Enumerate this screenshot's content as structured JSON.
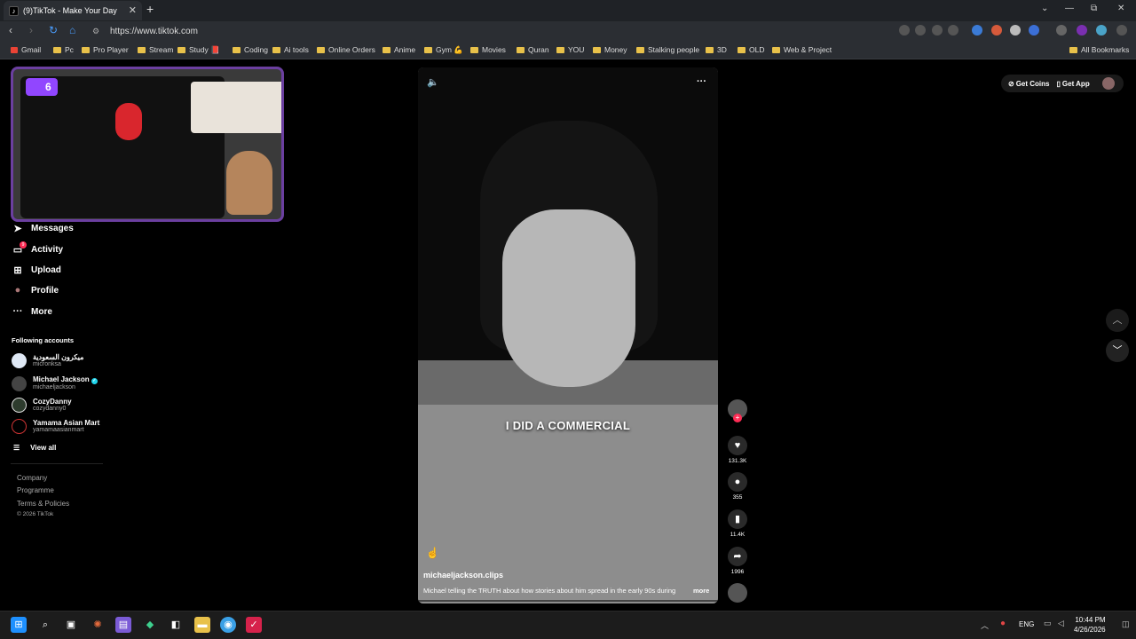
{
  "browser": {
    "tab_title": "(9)TikTok - Make Your Day",
    "tab_favicon": "tiktok-icon",
    "tab_close": "✕",
    "new_tab": "+",
    "url": "https://www.tiktok.com",
    "window_controls": {
      "dropdown": "⌄",
      "minimize": "—",
      "restore": "⧉",
      "close": "✕"
    },
    "nav": {
      "back": "‹",
      "forward": "›",
      "reload": "↻",
      "home": "⌂"
    },
    "bookmarks": [
      "Gmail",
      "Pc",
      "Pro Player",
      "Stream",
      "Study 📕",
      "Coding",
      "Ai tools",
      "Online Orders",
      "Anime",
      "Gym 💪",
      "Movies",
      "Quran",
      "YOU",
      "Money",
      "Stalking people",
      "3D",
      "OLD",
      "Web & Project"
    ],
    "all_bookmarks": "All Bookmarks"
  },
  "webcam": {
    "badge_count": "6"
  },
  "sidebar": {
    "nav": [
      {
        "label": "Messages",
        "icon": "send-icon",
        "glyph": "➤"
      },
      {
        "label": "Activity",
        "icon": "inbox-icon",
        "glyph": "▭",
        "badge": "9"
      },
      {
        "label": "Upload",
        "icon": "plus-square-icon",
        "glyph": "⊞"
      },
      {
        "label": "Profile",
        "icon": "avatar-icon",
        "glyph": "●"
      },
      {
        "label": "More",
        "icon": "ellipsis-icon",
        "glyph": "···"
      }
    ],
    "following_title": "Following accounts",
    "accounts": [
      {
        "name": "ميكرون السعودية",
        "handle": "micronksa"
      },
      {
        "name": "Michael Jackson",
        "handle": "michaeljackson",
        "verified": true
      },
      {
        "name": "CozyDanny",
        "handle": "cozydanny0"
      },
      {
        "name": "Yamama Asian Mart",
        "handle": "yamamaasianmart"
      }
    ],
    "view_all": "View all",
    "footer": {
      "company": "Company",
      "programme": "Programme",
      "terms": "Terms & Policies",
      "copyright": "© 2026 TikTok"
    }
  },
  "video": {
    "caption": "I DID A COMMERCIAL",
    "author": "michaeljackson.clips",
    "description": "Michael telling the TRUTH about how stories about him spread in the early 90s during",
    "more": "more",
    "volume_glyph": "🔈",
    "menu_glyph": "···"
  },
  "actions": {
    "likes": "131.3K",
    "comments": "355",
    "saves": "11.4K",
    "shares": "1996",
    "follow_glyph": "+",
    "like_glyph": "♥",
    "comment_glyph": "●",
    "save_glyph": "▮",
    "share_glyph": "➦"
  },
  "header": {
    "get_coins": "Get Coins",
    "get_app": "Get App"
  },
  "scroll": {
    "up": "︿",
    "down": "﹀"
  },
  "taskbar": {
    "language": "ENG",
    "time": "10:44 PM",
    "date": "4/26/2026"
  },
  "colors": {
    "tiktok_red": "#fe2c55",
    "twitch_purple": "#9146ff",
    "chrome_dark": "#2b2e33"
  }
}
